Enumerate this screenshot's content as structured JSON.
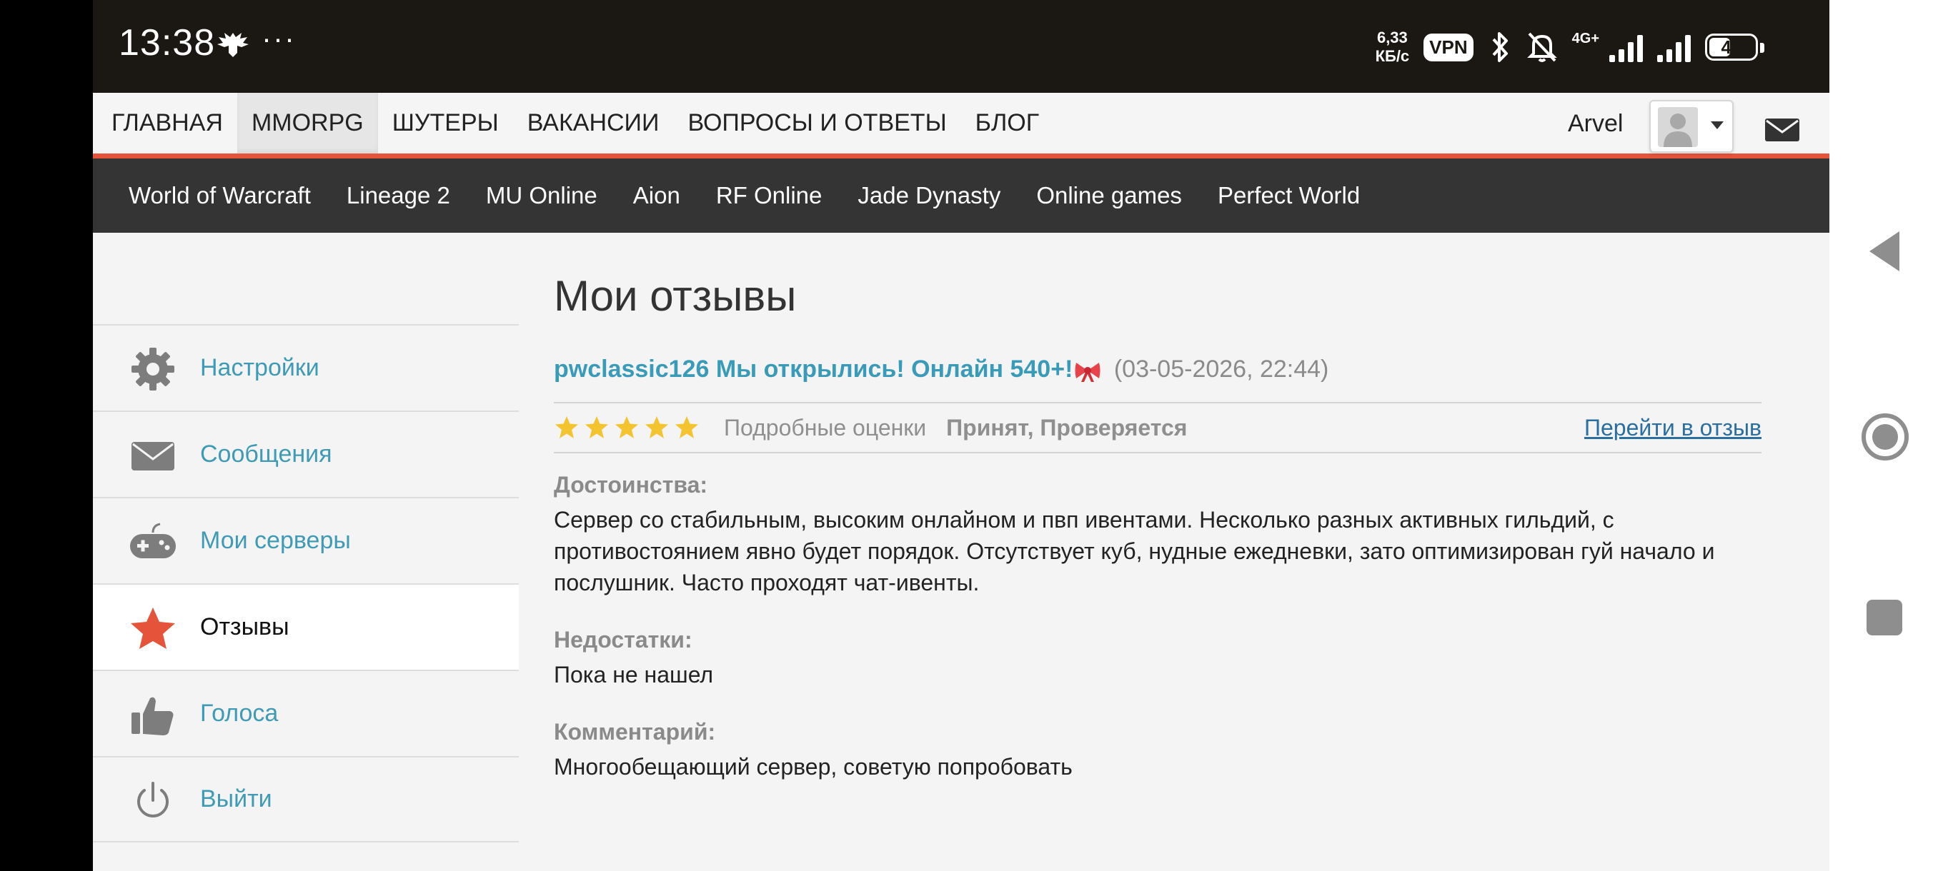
{
  "status_bar": {
    "time": "13:38",
    "dots": "···",
    "net_speed_value": "6,33",
    "net_speed_unit": "КБ/с",
    "vpn": "VPN",
    "network_type": "4G+",
    "battery_percent": "47",
    "battery_level": 0.47
  },
  "top_nav": {
    "items": [
      "ГЛАВНАЯ",
      "MMORPG",
      "ШУТЕРЫ",
      "ВАКАНСИИ",
      "ВОПРОСЫ И ОТВЕТЫ",
      "БЛОГ"
    ],
    "active": "MMORPG",
    "user_name": "Arvel",
    "accent_color": "#e5533a"
  },
  "sub_nav": {
    "items": [
      "World of Warcraft",
      "Lineage 2",
      "MU Online",
      "Aion",
      "RF Online",
      "Jade Dynasty",
      "Online games",
      "Perfect World"
    ]
  },
  "sidebar": {
    "items": [
      {
        "label": "Настройки",
        "icon": "gear-icon"
      },
      {
        "label": "Сообщения",
        "icon": "envelope-icon"
      },
      {
        "label": "Мои серверы",
        "icon": "gamepad-icon"
      },
      {
        "label": "Отзывы",
        "icon": "star-icon",
        "active": true
      },
      {
        "label": "Голоса",
        "icon": "thumbs-up-icon"
      },
      {
        "label": "Выйти",
        "icon": "power-icon"
      }
    ]
  },
  "main": {
    "title": "Мои отзывы",
    "review": {
      "server_title": "pwclassic126 Мы открылись! Онлайн 540+!",
      "emoji": "bow-emoji-icon",
      "date": "(03-05-2026, 22:44)",
      "stars": 5,
      "detail_ratings": "Подробные оценки",
      "status": "Принят, Проверяется",
      "goto_link": "Перейти в отзыв",
      "pros_label": "Достоинства:",
      "pros_text": "Сервер со стабильным, высоким онлайном и пвп ивентами. Несколько разных активных гильдий, с противостоянием явно будет порядок. Отсутствует куб, нудные ежедневки, зато оптимизирован гуй начало и послушник. Часто проходят чат-ивенты.",
      "cons_label": "Недостатки:",
      "cons_text": "Пока не нашел",
      "comment_label": "Комментарий:",
      "comment_text": "Многообещающий сервер, советую попробовать"
    }
  }
}
